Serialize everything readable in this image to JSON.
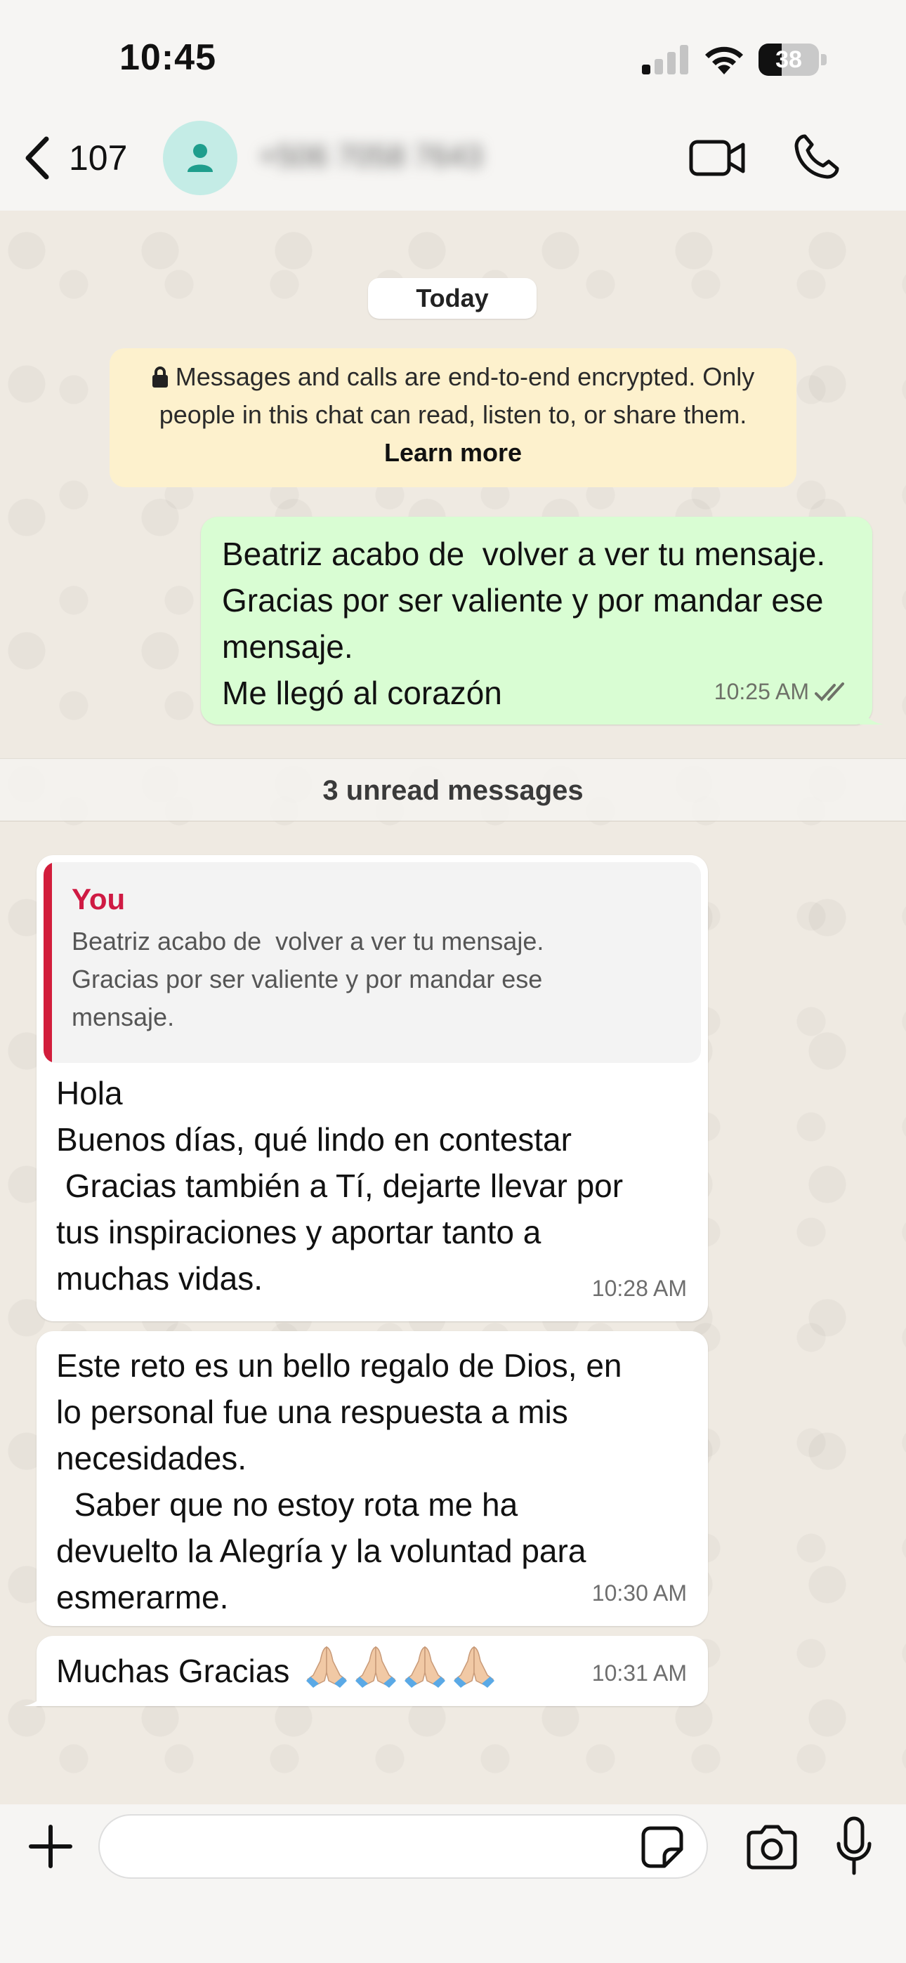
{
  "status_bar": {
    "time": "10:45",
    "battery_level": "38",
    "battery_fraction": 0.38,
    "signal_bars_active": 1
  },
  "header": {
    "back_count": "107",
    "contact_name": "+506 7058 7643",
    "icons": [
      "chevron-left-icon",
      "person-icon",
      "video-camera-icon",
      "phone-icon"
    ]
  },
  "chat": {
    "date_chip": "Today",
    "encryption_notice": {
      "text": "Messages and calls are end-to-end encrypted. Only people in this chat can read, listen to, or share them.",
      "link": "Learn more"
    },
    "outgoing_message": {
      "text": "Beatriz acabo de  volver a ver tu mensaje. Gracias por ser valiente y por mandar ese mensaje.\nMe llegó al corazón",
      "time": "10:25 AM",
      "status": "read"
    },
    "unread_divider": "3 unread messages",
    "incoming_messages": [
      {
        "quote_author": "You",
        "quote_text": "Beatriz acabo de  volver a ver tu mensaje.\nGracias por ser valiente y por mandar ese\nmensaje.",
        "text": "Hola\nBuenos días, qué lindo en contestar\n Gracias también a Tí, dejarte llevar por\ntus inspiraciones y aportar tanto a\nmuchas vidas.",
        "time": "10:28 AM"
      },
      {
        "text": "Este reto es un bello regalo de Dios, en\nlo personal fue una respuesta a mis\nnecesidades.\n  Saber que no estoy rota me ha\ndevuelto la Alegría y la voluntad para\nesmerarme.",
        "time": "10:30 AM"
      },
      {
        "text": "Muchas Gracias",
        "emoji": "🙏🏼🙏🏼🙏🏼🙏🏼",
        "time": "10:31 AM"
      }
    ]
  },
  "composer": {
    "placeholder": "",
    "icons": [
      "plus-icon",
      "sticker-icon",
      "camera-icon",
      "microphone-icon"
    ]
  },
  "colors": {
    "outgoing_bubble": "#d9fdd3",
    "incoming_bubble": "#ffffff",
    "quote_accent": "#d21d3c",
    "notice_bg": "#fdf1cd",
    "avatar_bg": "#c4ece6",
    "avatar_icon": "#1f9e8d"
  }
}
